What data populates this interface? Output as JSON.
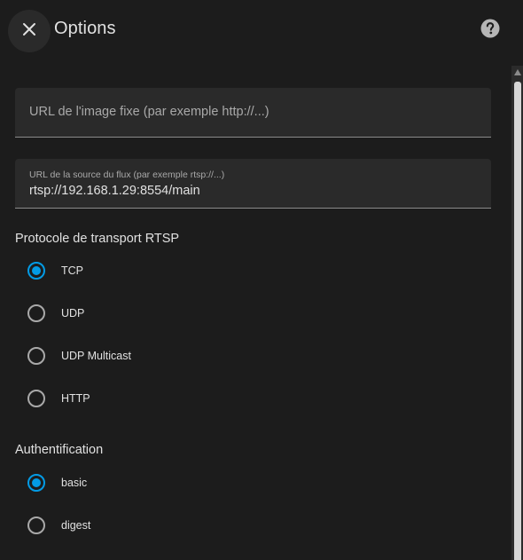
{
  "header": {
    "title": "Options",
    "close_icon": "close-icon",
    "help_icon": "help-circle-icon"
  },
  "fields": {
    "still_image_url": {
      "placeholder": "URL de l'image fixe (par exemple http://...)",
      "value": ""
    },
    "stream_source_url": {
      "label": "URL de la source du flux (par exemple rtsp://...)",
      "value": "rtsp://192.168.1.29:8554/main"
    }
  },
  "rtsp_transport": {
    "label": "Protocole de transport RTSP",
    "options": [
      {
        "label": "TCP",
        "checked": true
      },
      {
        "label": "UDP",
        "checked": false
      },
      {
        "label": "UDP Multicast",
        "checked": false
      },
      {
        "label": "HTTP",
        "checked": false
      }
    ]
  },
  "authentication": {
    "label": "Authentification",
    "options": [
      {
        "label": "basic",
        "checked": true
      },
      {
        "label": "digest",
        "checked": false
      }
    ]
  },
  "colors": {
    "accent": "#039be5",
    "background": "#1c1c1c",
    "field_background": "#2a2a2a"
  }
}
